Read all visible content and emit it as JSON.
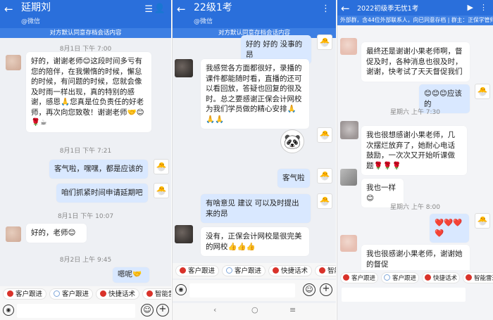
{
  "p1": {
    "title": "延期刘",
    "subtitle": "@微信",
    "notice": "对方默认同意存档会话内容",
    "ts1": "8月1日 下午 7:00",
    "msg1": "好的，谢谢老师😊这段时间多亏有您的陪伴，在我懒惰的时候，懈怠的时候，有问题的时候，您就会像及时雨一样出现，真的特别的感谢，感恩🙏您真是位负责任的好老师，再次向您致敬！谢谢老师🤝😊🌹☕",
    "ts2": "8月1日 下午 7:21",
    "msg2": "客气啦，嘿嘿，都是应该的",
    "msg3": "咱们抓紧时间申请延期吧",
    "ts3": "8月1日 下午 10:07",
    "msg4": "好的，老师😊",
    "ts4": "8月2日 上午 9:45",
    "msg5": "嗯呢🤝",
    "quick": [
      "客户跟进",
      "客户跟进",
      "快捷话术",
      "智能雷"
    ]
  },
  "p2": {
    "title": "22级1考",
    "subtitle": "@微信",
    "notice": "对方默认同意存档会话内容",
    "msg1": "好的 好的 没事的昂",
    "msg2": "我感觉各方面都很好，录播的课件都能随时看，直播的还可以看回放，答疑也回复的很及时。总之要感谢正保会计网校为我们学员做的精心安排🙏🙏🙏",
    "msg3": "客气啦",
    "msg4": "有啥意见 建议 可以及时提出来的昂",
    "msg5": "没有，正保会计网校是很完美的网校👍👍👍",
    "quick": [
      "客户跟进",
      "客户跟进",
      "快捷话术",
      "智能"
    ]
  },
  "p3": {
    "title": "2022初级季无忧1考",
    "notice": "外部群，含44位外部联系人，向已同意存档 | 群主：正保学管师小果老师",
    "msg1": "最终还是谢谢小果老师啊，督促及时，各种消息也很及时，谢谢，快考试了天天督促我们",
    "msg2": "😊😊😊应该的",
    "ts1": "星期六 上午 7:30",
    "msg3": "我也很想感谢小果老师，几次摆烂放弃了，她耐心电话鼓励，一次次又开始听课做题🌹🌹🌹",
    "msg4": "我也一样😊",
    "ts2": "星期六 上午 8:00",
    "msg5": "❤️❤️❤️❤️",
    "msg6": "我也很感谢小果老师，谢谢她的督促",
    "quick": [
      "客户跟进",
      "客户跟进",
      "快捷话术",
      "智能雷达"
    ]
  },
  "nav": {
    "back": "‹",
    "home": "○",
    "menu": "≡"
  },
  "colors": {
    "header": "#2a6fdb",
    "notice": "#3d7fe3",
    "self_bubble": "#d9e8ff"
  }
}
